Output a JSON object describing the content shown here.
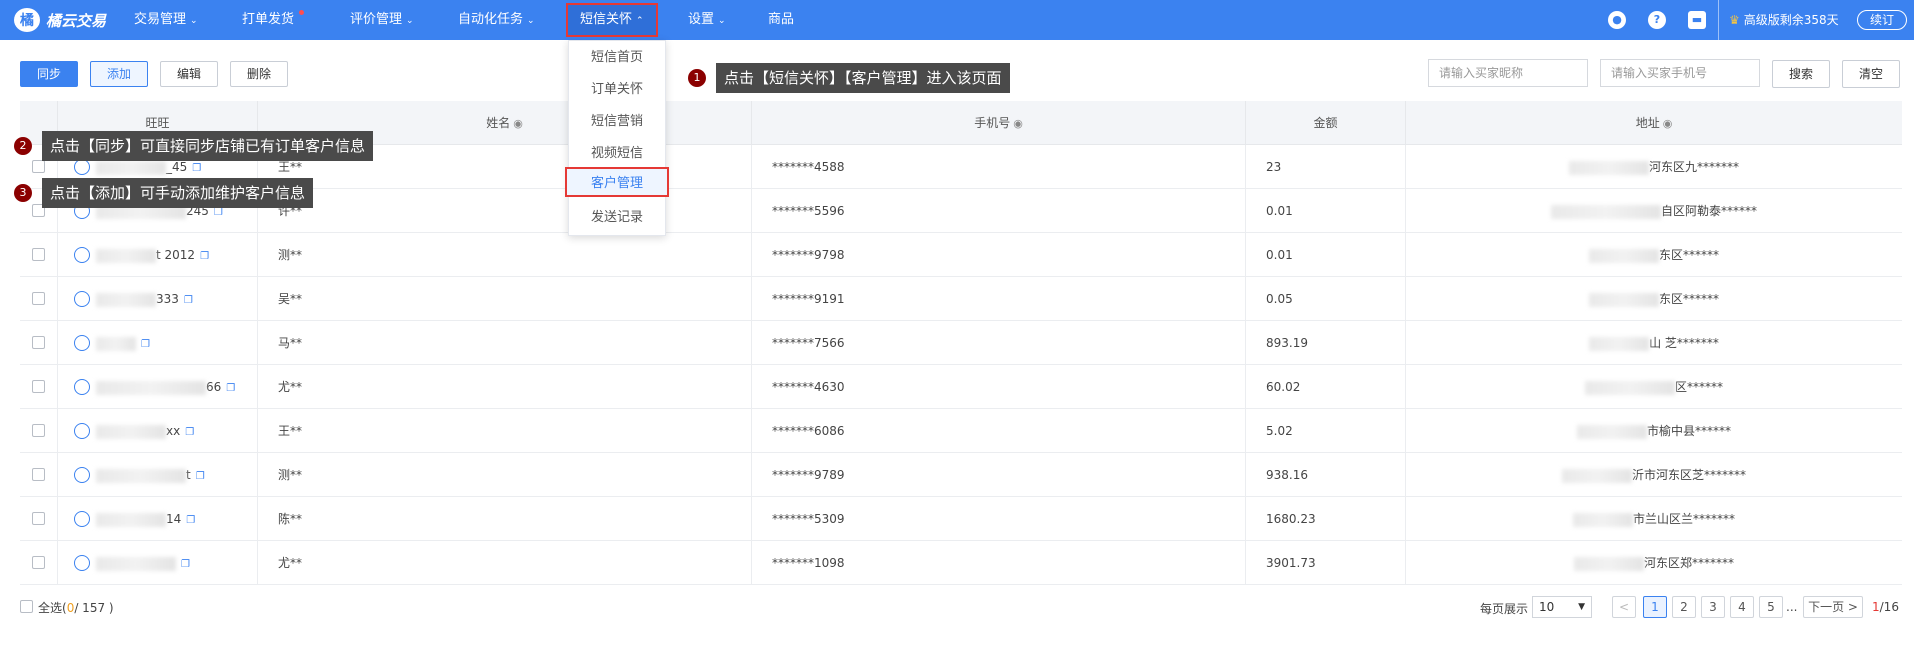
{
  "app": {
    "logo_text": "橘云交易",
    "logo_mark": "橘"
  },
  "nav": [
    {
      "label": "交易管理",
      "chev": "⌄"
    },
    {
      "label": "打单发货",
      "chev": ""
    },
    {
      "label": "评价管理",
      "chev": "⌄"
    },
    {
      "label": "自动化任务",
      "chev": "⌄"
    },
    {
      "label": "短信关怀",
      "chev": "⌃"
    },
    {
      "label": "设置",
      "chev": "⌄"
    },
    {
      "label": "商品",
      "chev": ""
    }
  ],
  "top_right": {
    "vip_text": "高级版剩余358天",
    "renew_label": "续订",
    "crown": "♛",
    "icon_bell": "●",
    "icon_help": "?",
    "icon_ticket": "▬"
  },
  "toolbar": {
    "sync": "同步",
    "add": "添加",
    "edit": "编辑",
    "delete": "删除",
    "search_btn": "搜索",
    "clear_btn": "清空"
  },
  "search": {
    "buyer_nick_placeholder": "请输入买家昵称",
    "buyer_phone_placeholder": "请输入买家手机号"
  },
  "dropdown": [
    "短信首页",
    "订单关怀",
    "短信营销",
    "视频短信",
    "客户管理",
    "发送记录"
  ],
  "columns": {
    "wangwang": "旺旺",
    "name": "姓名",
    "phone": "手机号",
    "amount": "金额",
    "address": "地址",
    "eye": "◉"
  },
  "rows": [
    {
      "ww": "_45",
      "name": "王**",
      "phone": "*******4588",
      "amount": "23",
      "addr": "河东区九*******"
    },
    {
      "ww": "245",
      "name": "许**",
      "phone": "*******5596",
      "amount": "0.01",
      "addr": "自区阿勒泰******"
    },
    {
      "ww": "t 2012",
      "name": "测**",
      "phone": "*******9798",
      "amount": "0.01",
      "addr": "东区******"
    },
    {
      "ww": "333",
      "name": "吴**",
      "phone": "*******9191",
      "amount": "0.05",
      "addr": "东区******"
    },
    {
      "ww": "",
      "name": "马**",
      "phone": "*******7566",
      "amount": "893.19",
      "addr": "山 芝*******"
    },
    {
      "ww": "66",
      "name": "尤**",
      "phone": "*******4630",
      "amount": "60.02",
      "addr": "区******"
    },
    {
      "ww": "xx",
      "name": "王**",
      "phone": "*******6086",
      "amount": "5.02",
      "addr": "市榆中县******"
    },
    {
      "ww": "t",
      "name": "测**",
      "phone": "*******9789",
      "amount": "938.16",
      "addr": "沂市河东区芝*******"
    },
    {
      "ww": "14",
      "name": "陈**",
      "phone": "*******5309",
      "amount": "1680.23",
      "addr": "市兰山区兰*******"
    },
    {
      "ww": "",
      "name": "尤**",
      "phone": "*******1098",
      "amount": "3901.73",
      "addr": "河东区郑*******"
    }
  ],
  "tips": [
    {
      "num": "1",
      "text": "点击【短信关怀】【客户管理】进入该页面"
    },
    {
      "num": "2",
      "text": "点击【同步】可直接同步店铺已有订单客户信息"
    },
    {
      "num": "3",
      "text": "点击【添加】可手动添加维护客户信息"
    }
  ],
  "footer": {
    "select_all": "全选(",
    "selected": "0",
    "total": "/ 157 )",
    "per_page_label": "每页展示",
    "per_page_value": "10",
    "pages": [
      "<",
      "1",
      "2",
      "3",
      "4",
      "5"
    ],
    "ellipsis": "...",
    "next": "下一页 >",
    "current_page": "1",
    "page_count": "/16"
  }
}
